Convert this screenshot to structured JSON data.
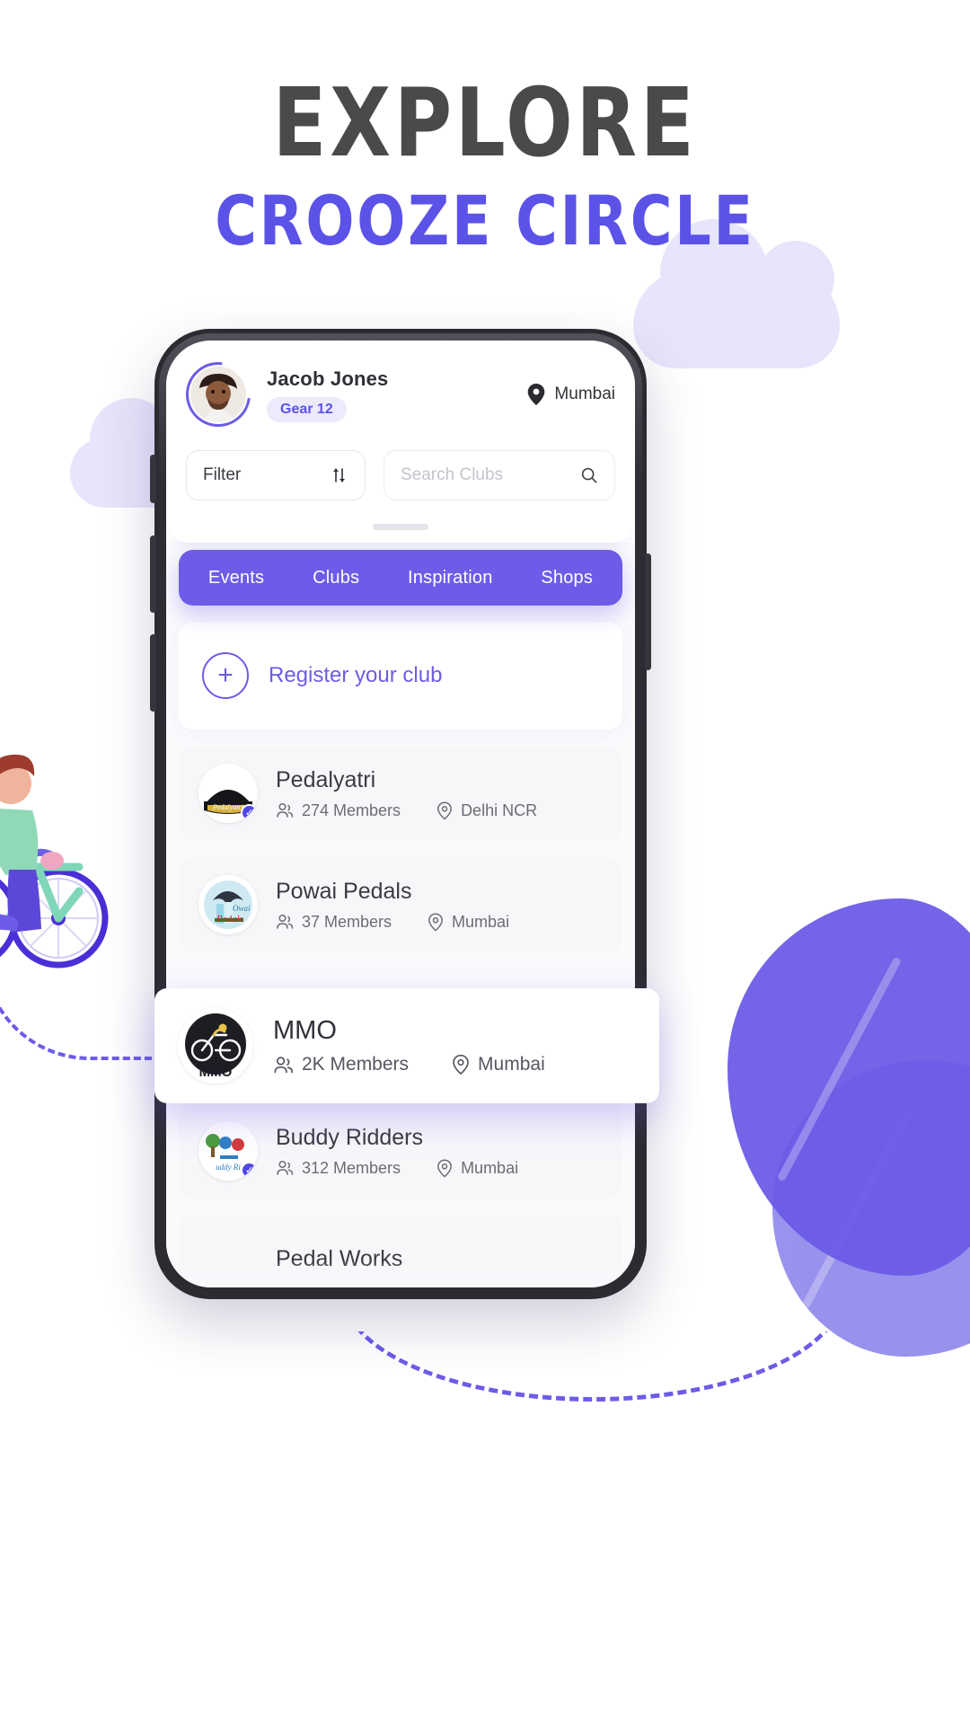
{
  "poster": {
    "headline": "EXPLORE",
    "subheadline": "CROOZE CIRCLE",
    "headline_color": "#4a4a4a",
    "subheadline_color": "#5b52e8",
    "accent_color": "#6c5ce7"
  },
  "app": {
    "profile": {
      "name": "Jacob Jones",
      "gear_badge": "Gear 12",
      "location": "Mumbai",
      "location_icon": "map-pin-icon",
      "avatar_icon": "avatar"
    },
    "tools": {
      "filter_label": "Filter",
      "filter_icon": "sliders-icon",
      "search_placeholder": "Search Clubs",
      "search_value": "",
      "search_icon": "search-icon"
    },
    "tabs": [
      {
        "label": "Events",
        "active": false
      },
      {
        "label": "Clubs",
        "active": false
      },
      {
        "label": "Inspiration",
        "active": false
      },
      {
        "label": "Shops",
        "active": false
      }
    ],
    "register": {
      "label": "Register your club",
      "icon": "plus-icon"
    },
    "clubs": [
      {
        "name": "Pedalyatri",
        "members": "274 Members",
        "location": "Delhi NCR",
        "verified": true,
        "logo_icon": "pedalyatri-logo"
      },
      {
        "name": "Powai Pedals",
        "members": "37 Members",
        "location": "Mumbai",
        "verified": false,
        "logo_icon": "powai-pedals-logo"
      },
      {
        "name": "Buddy Ridders",
        "members": "312 Members",
        "location": "Mumbai",
        "verified": true,
        "logo_icon": "buddy-ridders-logo"
      },
      {
        "name": "Pedal Works",
        "members": "",
        "location": "",
        "verified": false,
        "logo_icon": "pedal-works-logo"
      }
    ],
    "highlighted_club": {
      "name": "MMO",
      "members": "2K Members",
      "location": "Mumbai",
      "logo_icon": "mmo-logo"
    },
    "meta_icons": {
      "members_icon": "people-icon",
      "location_icon": "map-pin-icon"
    }
  }
}
